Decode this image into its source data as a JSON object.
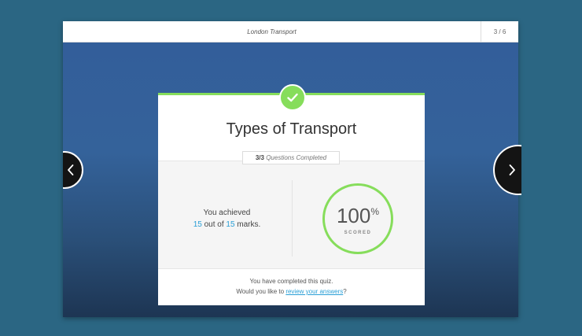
{
  "header": {
    "title": "London Transport",
    "pager": "3  /  6"
  },
  "card": {
    "title": "Types of Transport",
    "questions_count": "3/3",
    "questions_label": "Questions Completed",
    "achieved_line1": "You achieved",
    "score_obtained": "15",
    "out_of_text": " out of ",
    "score_total": "15",
    "marks_text": " marks.",
    "score_value": "100",
    "score_unit": "%",
    "score_label": "SCORED",
    "completed_text": "You have completed this quiz.",
    "review_prefix": "Would you like to ",
    "review_link": "review your answers",
    "review_suffix": "?"
  },
  "colors": {
    "accent_green": "#86dd5b",
    "link_blue": "#2a9fd6",
    "page_background": "#2b6683"
  },
  "icons": {
    "badge": "check-icon",
    "prev": "chevron-left-icon",
    "next": "chevron-right-icon"
  }
}
